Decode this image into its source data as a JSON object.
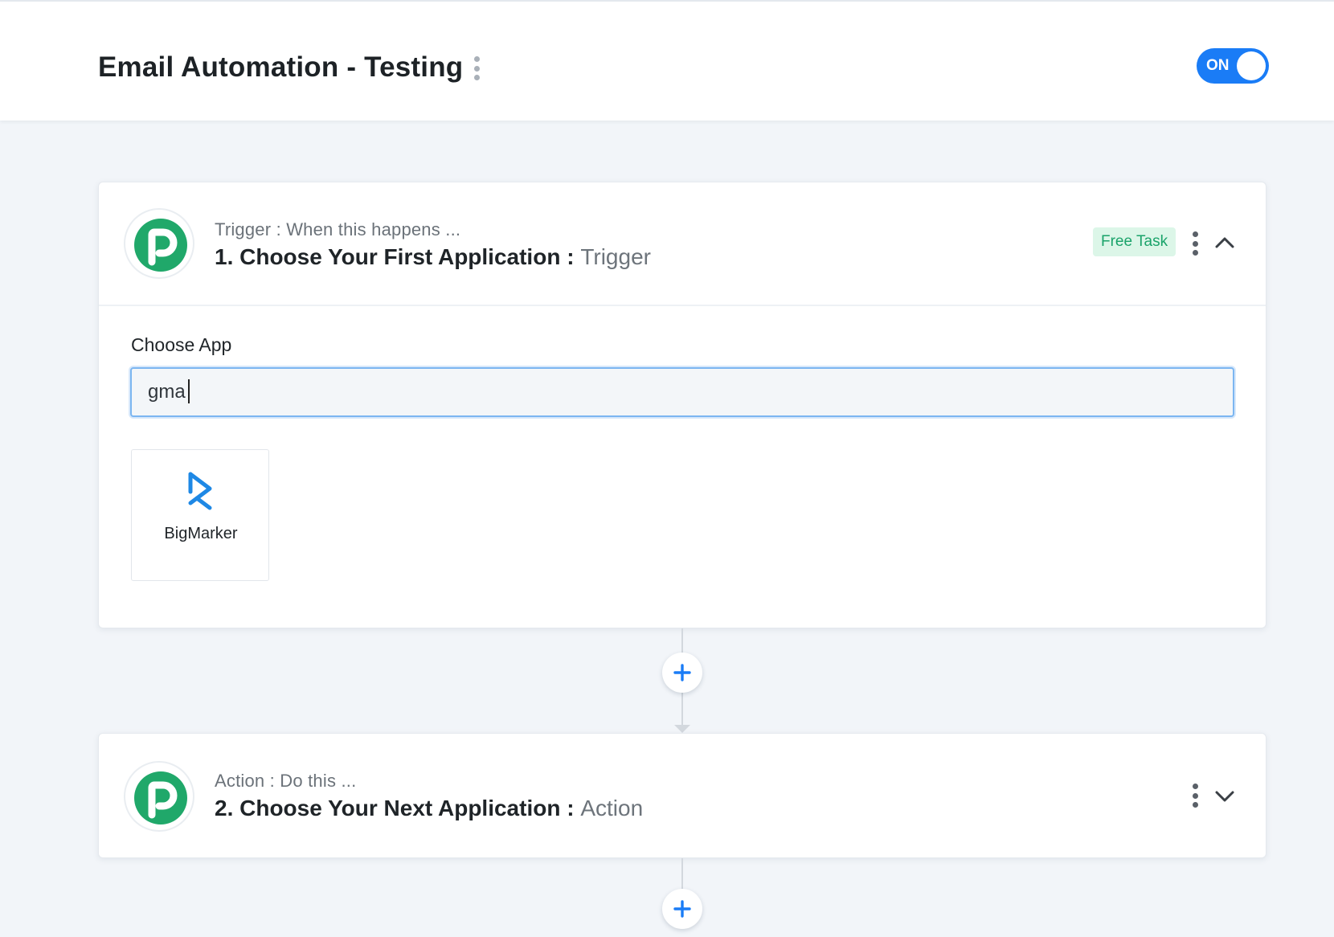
{
  "header": {
    "title": "Email Automation - Testing",
    "menu_icon": "kebab-menu-icon",
    "toggle": {
      "label": "ON",
      "state": "on",
      "color": "#1a7cf6"
    }
  },
  "trigger": {
    "logo_icon": "pabbly-logo-icon",
    "subtitle": "Trigger : When this happens ...",
    "title": "1. Choose Your First Application :",
    "title_suffix": "Trigger",
    "badge": "Free Task",
    "collapse_icon": "chevron-up-icon",
    "field_label": "Choose App",
    "search_value": "gma",
    "results": [
      {
        "name": "BigMarker",
        "icon": "bigmarker-logo-icon"
      }
    ]
  },
  "action": {
    "logo_icon": "pabbly-logo-icon",
    "subtitle": "Action : Do this ...",
    "title": "2. Choose Your Next Application :",
    "title_suffix": "Action",
    "expand_icon": "chevron-down-icon"
  },
  "colors": {
    "accent": "#1a7cf6",
    "brand_green": "#20a86a",
    "badge_bg": "#dcf6e8",
    "badge_text": "#1aa36a"
  }
}
